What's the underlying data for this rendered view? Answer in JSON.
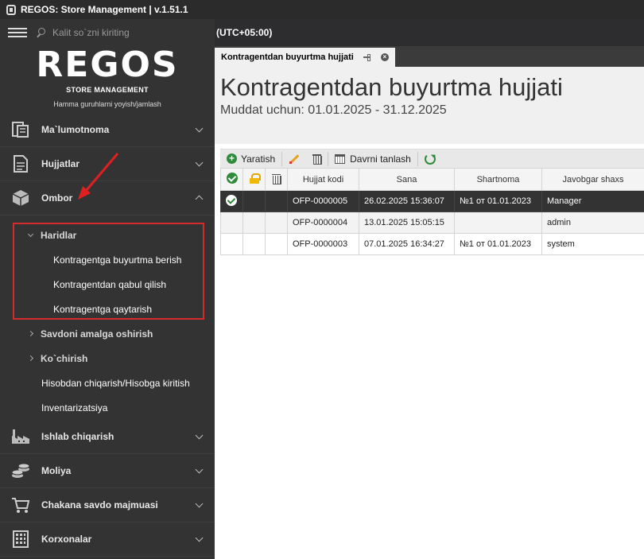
{
  "window": {
    "title": "REGOS: Store Management | v.1.51.1"
  },
  "sidebar": {
    "search_placeholder": "Kalit so`zni kiriting",
    "logo": "REGOS",
    "logo_sub": "STORE MANAGEMENT",
    "collapse_all": "Hamma guruhlarni yoyish/jamlash",
    "items": [
      {
        "label": "Ma`lumotnoma",
        "icon": "reference-icon"
      },
      {
        "label": "Hujjatlar",
        "icon": "documents-icon"
      },
      {
        "label": "Ombor",
        "icon": "box-icon"
      }
    ],
    "ombor_sub": {
      "haridlar": "Haridlar",
      "leaves": [
        "Kontragentga buyurtma berish",
        "Kontragentdan qabul qilish",
        "Kontragentga qaytarish"
      ],
      "savdo": "Savdoni amalga oshirish",
      "kochirish": "Ko`chirish",
      "hisob": "Hisobdan chiqarish/Hisobga kiritish",
      "inventar": "Inventarizatsiya"
    },
    "bottom_items": [
      {
        "label": "Ishlab chiqarish",
        "icon": "factory-icon"
      },
      {
        "label": "Moliya",
        "icon": "coins-icon"
      },
      {
        "label": "Chakana savdo majmuasi",
        "icon": "cart-icon"
      },
      {
        "label": "Korxonalar",
        "icon": "building-icon"
      }
    ]
  },
  "header": {
    "timezone": "(UTC+05:00)"
  },
  "doc_tab": {
    "label": "Kontragentdan buyurtma hujjati"
  },
  "document": {
    "title": "Kontragentdan buyurtma hujjati",
    "period": "Muddat uchun: 01.01.2025 - 31.12.2025"
  },
  "toolbar": {
    "create": "Yaratish",
    "period_select": "Davrni tanlash"
  },
  "grid": {
    "columns": [
      "Hujjat kodi",
      "Sana",
      "Shartnoma",
      "Javobgar shaxs"
    ],
    "rows": [
      {
        "code": "OFP-0000005",
        "date": "26.02.2025 15:36:07",
        "contract": "№1 от 01.01.2023",
        "responsible": "Manager",
        "approved": true
      },
      {
        "code": "OFP-0000004",
        "date": "13.01.2025 15:05:15",
        "contract": "",
        "responsible": "admin",
        "approved": false
      },
      {
        "code": "OFP-0000003",
        "date": "07.01.2025 16:34:27",
        "contract": "№1 от 01.01.2023",
        "responsible": "system",
        "approved": false
      }
    ]
  },
  "colors": {
    "highlight_box": "#d42b2b",
    "accent_green": "#2e8b3a",
    "sidebar_bg": "#333333"
  }
}
